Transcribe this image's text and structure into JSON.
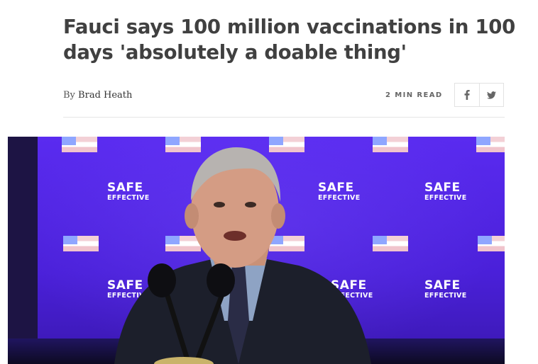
{
  "article": {
    "headline": "Fauci says 100 million vaccinations in 100 days 'absolutely a doable thing'",
    "byline_prefix": "By",
    "author": "Brad Heath",
    "read_time": "2 MIN READ"
  },
  "share": {
    "facebook_icon": "facebook-icon",
    "twitter_icon": "twitter-icon"
  },
  "photo": {
    "backdrop_logo_line1": "SAFE",
    "backdrop_logo_line2": "EFFECTIVE"
  }
}
